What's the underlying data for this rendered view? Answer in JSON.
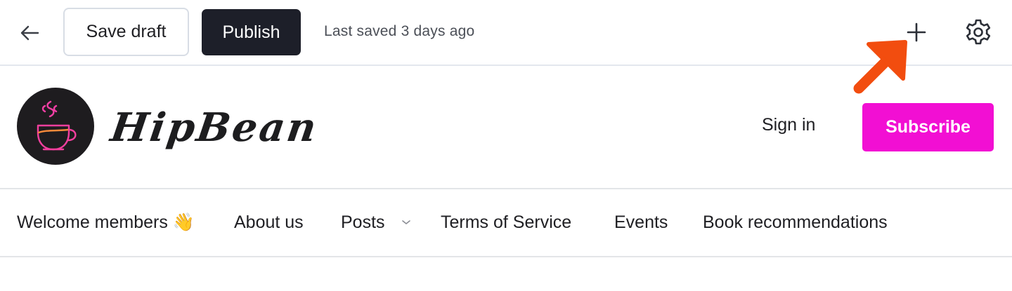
{
  "toolbar": {
    "back_icon": "arrow-left-icon",
    "save_draft_label": "Save draft",
    "publish_label": "Publish",
    "last_saved_text": "Last saved 3 days ago",
    "add_icon": "plus-icon",
    "settings_icon": "gear-icon"
  },
  "annotation": {
    "arrow_icon": "arrow-up-right-icon",
    "arrow_color": "#f24d0f"
  },
  "header": {
    "logo_icon": "coffee-cup-icon",
    "brand_name": "HipBean",
    "sign_in_label": "Sign in",
    "subscribe_label": "Subscribe",
    "subscribe_color": "#f20fd3"
  },
  "nav": {
    "items": [
      {
        "label": "Welcome members 👋"
      },
      {
        "label": "About us"
      },
      {
        "label": "Posts",
        "icon": "chevron-down-icon"
      },
      {
        "label": "Terms of Service"
      },
      {
        "label": "Events"
      },
      {
        "label": "Book recommendations"
      }
    ]
  }
}
